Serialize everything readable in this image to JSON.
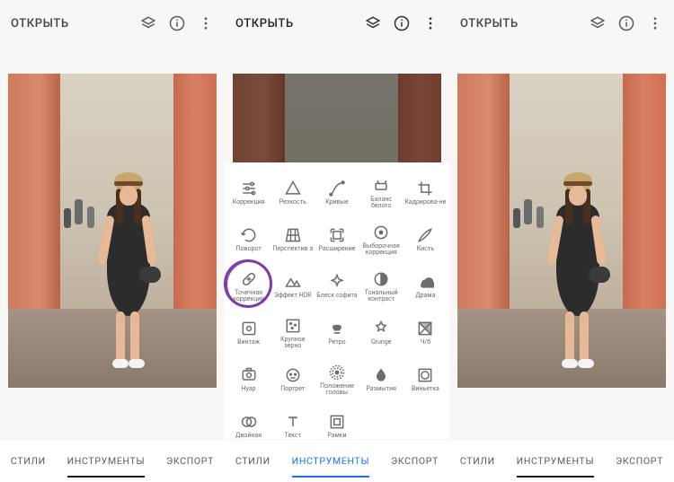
{
  "header": {
    "open_label": "ОТКРЫТЬ"
  },
  "nav": {
    "styles": "СТИЛИ",
    "tools": "ИНСТРУМЕНТЫ",
    "export": "ЭКСПОРТ"
  },
  "tools": [
    {
      "id": "tune",
      "label": "Коррекция"
    },
    {
      "id": "details",
      "label": "Резкость"
    },
    {
      "id": "curves",
      "label": "Кривые"
    },
    {
      "id": "white-bal",
      "label": "Баланс белого"
    },
    {
      "id": "crop",
      "label": "Кадрирова-не"
    },
    {
      "id": "rotate",
      "label": "Поворот"
    },
    {
      "id": "perspective",
      "label": "Перспектив а"
    },
    {
      "id": "expand",
      "label": "Расширение"
    },
    {
      "id": "selective",
      "label": "Выборочная коррекция"
    },
    {
      "id": "brush",
      "label": "Кисть"
    },
    {
      "id": "healing",
      "label": "Точечная коррекция"
    },
    {
      "id": "hdr",
      "label": "Эффект HDR"
    },
    {
      "id": "glamour",
      "label": "Блеск софита"
    },
    {
      "id": "tonal",
      "label": "Тональный контраст"
    },
    {
      "id": "drama",
      "label": "Драма"
    },
    {
      "id": "vintage",
      "label": "Винтаж"
    },
    {
      "id": "grainy",
      "label": "Крупное зерно"
    },
    {
      "id": "retrolux",
      "label": "Ретро"
    },
    {
      "id": "grunge",
      "label": "Grunge"
    },
    {
      "id": "bw",
      "label": "Ч/б"
    },
    {
      "id": "noir",
      "label": "Нуар"
    },
    {
      "id": "portrait",
      "label": "Портрет"
    },
    {
      "id": "headpose",
      "label": "Положение головы"
    },
    {
      "id": "blur",
      "label": "Размытия"
    },
    {
      "id": "vignette",
      "label": "Виньетка"
    },
    {
      "id": "double",
      "label": "Двойная"
    },
    {
      "id": "text",
      "label": "Текст"
    },
    {
      "id": "frames",
      "label": "Рамки"
    }
  ],
  "highlighted_tool": "healing"
}
